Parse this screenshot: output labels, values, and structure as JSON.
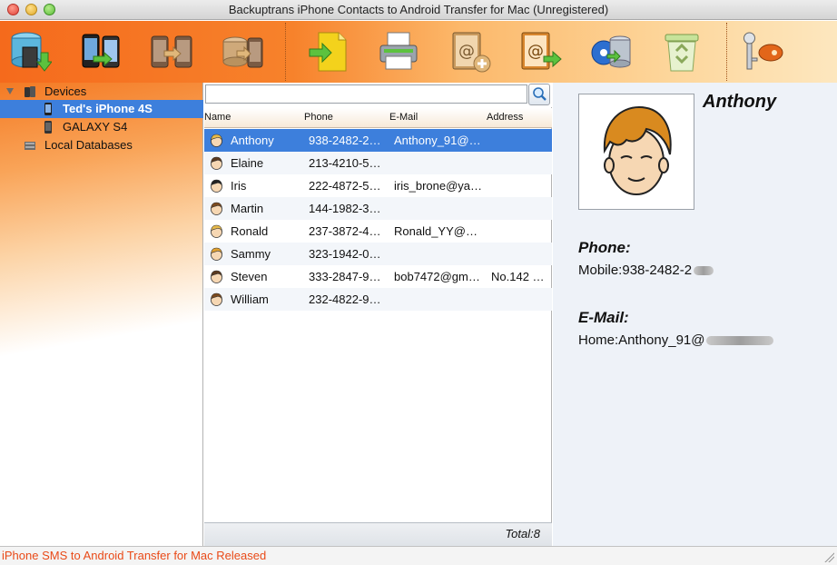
{
  "window": {
    "title": "Backuptrans iPhone Contacts to Android Transfer for Mac (Unregistered)"
  },
  "toolbar": {
    "buttons": [
      {
        "icon": "backup-database-icon"
      },
      {
        "icon": "phone-transfer-icon"
      },
      {
        "icon": "android-to-android-icon"
      },
      {
        "icon": "database-to-phone-icon"
      },
      {
        "icon": "import-file-icon"
      },
      {
        "icon": "print-icon"
      },
      {
        "icon": "add-contact-icon"
      },
      {
        "icon": "export-contacts-icon"
      },
      {
        "icon": "restore-database-icon"
      },
      {
        "icon": "recycle-bin-icon"
      },
      {
        "icon": "register-key-icon"
      }
    ]
  },
  "sidebar": {
    "devices_label": "Devices",
    "items": [
      {
        "label": "Ted's iPhone 4S",
        "selected": true
      },
      {
        "label": "GALAXY S4",
        "selected": false
      }
    ],
    "local_db_label": "Local Databases"
  },
  "search": {
    "value": "",
    "placeholder": ""
  },
  "table": {
    "columns": [
      "Name",
      "Phone",
      "E-Mail",
      "Address"
    ],
    "rows": [
      {
        "name": "Anthony",
        "phone": "938-2482-2…",
        "email": "Anthony_91@…",
        "address": "",
        "selected": true
      },
      {
        "name": "Elaine",
        "phone": "213-4210-5…",
        "email": "",
        "address": ""
      },
      {
        "name": "Iris",
        "phone": "222-4872-5…",
        "email": "iris_brone@ya…",
        "address": ""
      },
      {
        "name": "Martin",
        "phone": "144-1982-3…",
        "email": "",
        "address": ""
      },
      {
        "name": "Ronald",
        "phone": "237-3872-4…",
        "email": "Ronald_YY@…",
        "address": ""
      },
      {
        "name": "Sammy",
        "phone": "323-1942-0…",
        "email": "",
        "address": ""
      },
      {
        "name": "Steven",
        "phone": "333-2847-9…",
        "email": "bob7472@gm…",
        "address": "No.142 …"
      },
      {
        "name": "William",
        "phone": "232-4822-9…",
        "email": "",
        "address": ""
      }
    ],
    "total": "Total:8"
  },
  "detail": {
    "name": "Anthony",
    "phone_heading": "Phone:",
    "phone_value": "Mobile:938-2482-2",
    "email_heading": "E-Mail:",
    "email_value": "Home:Anthony_91@"
  },
  "status": {
    "text": "iPhone SMS to Android Transfer for Mac Released"
  },
  "colors": {
    "accent": "#3d7fdc",
    "toolbar_orange": "#f56a1c",
    "status_text": "#e94a18"
  }
}
